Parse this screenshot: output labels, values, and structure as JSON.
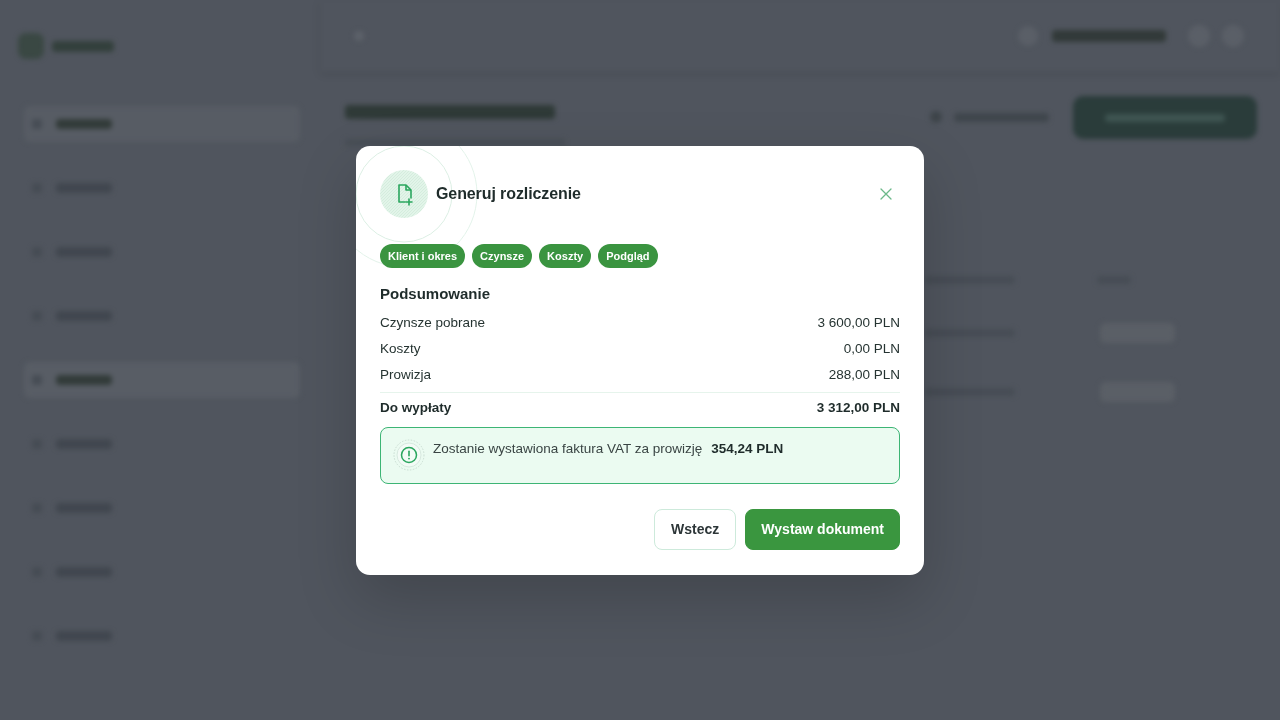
{
  "dialog": {
    "title": "Generuj rozliczenie",
    "steps": [
      {
        "label": "Klient i okres"
      },
      {
        "label": "Czynsze"
      },
      {
        "label": "Koszty"
      },
      {
        "label": "Podgląd"
      }
    ],
    "summary": {
      "heading": "Podsumowanie",
      "rows": [
        {
          "label": "Czynsze pobrane",
          "value": "3 600,00 PLN"
        },
        {
          "label": "Koszty",
          "value": "0,00 PLN"
        },
        {
          "label": "Prowizja",
          "value": "288,00 PLN"
        }
      ],
      "total": {
        "label": "Do wypłaty",
        "value": "3 312,00 PLN"
      }
    },
    "notice": {
      "text": "Zostanie wystawiona faktura VAT za prowizję **354,24 PLN**"
    },
    "buttons": [
      {
        "label": "Wstecz",
        "kind": "secondary"
      },
      {
        "label": "Wystaw dokument",
        "kind": "primary"
      }
    ]
  }
}
